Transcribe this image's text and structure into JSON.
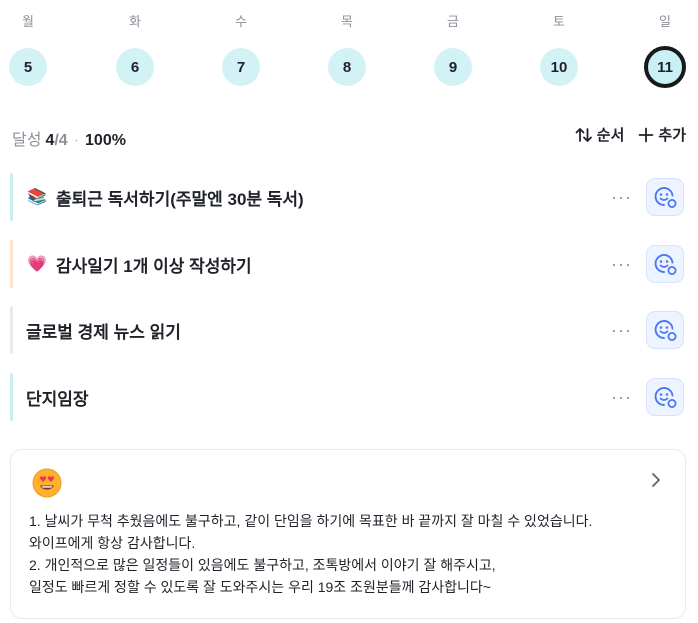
{
  "week": {
    "days": [
      {
        "label": "월",
        "date": "5"
      },
      {
        "label": "화",
        "date": "6"
      },
      {
        "label": "수",
        "date": "7"
      },
      {
        "label": "목",
        "date": "8"
      },
      {
        "label": "금",
        "date": "9"
      },
      {
        "label": "토",
        "date": "10"
      },
      {
        "label": "일",
        "date": "11",
        "selected": true
      }
    ]
  },
  "summary": {
    "label": "달성",
    "done": "4",
    "total": "/4",
    "separator": "·",
    "percent": "100%"
  },
  "actions": {
    "sort_label": "순서",
    "add_label": "추가"
  },
  "habits": [
    {
      "emoji": "📚",
      "title": "출퇴근 독서하기(주말엔 30분 독서)",
      "more": "···",
      "bar_color": "#c8eef0"
    },
    {
      "emoji": "💗",
      "title": "감사일기 1개 이상 작성하기",
      "more": "···",
      "bar_color": "#fbe3cf"
    },
    {
      "emoji": "",
      "title": "글로벌 경제 뉴스 읽기",
      "more": "···",
      "bar_color": "#e8eaed"
    },
    {
      "emoji": "",
      "title": "단지임장",
      "more": "···",
      "bar_color": "#c8eef0"
    }
  ],
  "note": {
    "lines": [
      "1. 날씨가 무척 추웠음에도 불구하고, 같이 단임을 하기에 목표한 바 끝까지 잘 마칠 수 있었습니다.",
      "와이프에게 항상 감사합니다.",
      "2. 개인적으로 많은 일정들이 있음에도 불구하고, 조톡방에서 이야기 잘 해주시고,",
      "일정도 빠르게 정할 수 있도록 잘 도와주시는 우리 19조 조원분들께 감사합니다~"
    ]
  },
  "colors": {
    "day_bg": "#d2f2f6",
    "check_bg": "#eef4ff",
    "check_icon": "#4a78f0"
  }
}
